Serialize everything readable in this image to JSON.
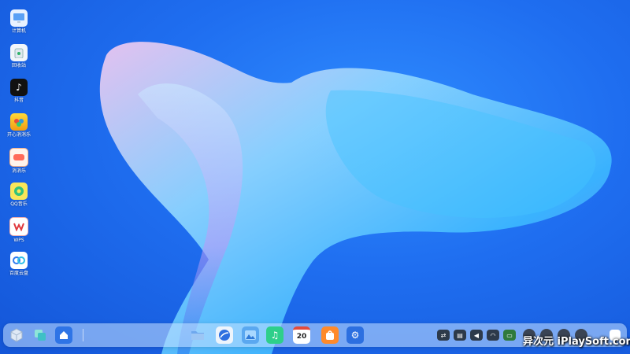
{
  "desktop_icons": [
    {
      "label": "计算机",
      "icon": "computer-icon"
    },
    {
      "label": "回收站",
      "icon": "recycle-bin-icon"
    },
    {
      "label": "抖音",
      "icon": "douyin-icon"
    },
    {
      "label": "开心消消乐",
      "icon": "happy-match-icon"
    },
    {
      "label": "消消乐",
      "icon": "match-game-icon"
    },
    {
      "label": "QQ音乐",
      "icon": "qq-music-icon"
    },
    {
      "label": "WPS",
      "icon": "wps-icon"
    },
    {
      "label": "百度云盘",
      "icon": "baidu-netdisk-icon"
    }
  ],
  "taskbar": {
    "left_buttons": [
      "start-menu-icon",
      "multitask-view-icon",
      "home-icon"
    ],
    "apps": [
      "file-manager-icon",
      "browser-icon",
      "gallery-icon",
      "music-icon",
      "calendar-icon",
      "app-store-icon",
      "settings-icon"
    ],
    "calendar_day": "20",
    "tray": [
      "toggle-icon",
      "keyboard-icon",
      "volume-icon",
      "wifi-icon",
      "battery-icon"
    ]
  },
  "watermark": "异次元 iPlaySoft.com",
  "colors": {
    "background": "#1f6ef0",
    "taskbar": "#c8e1ff"
  }
}
